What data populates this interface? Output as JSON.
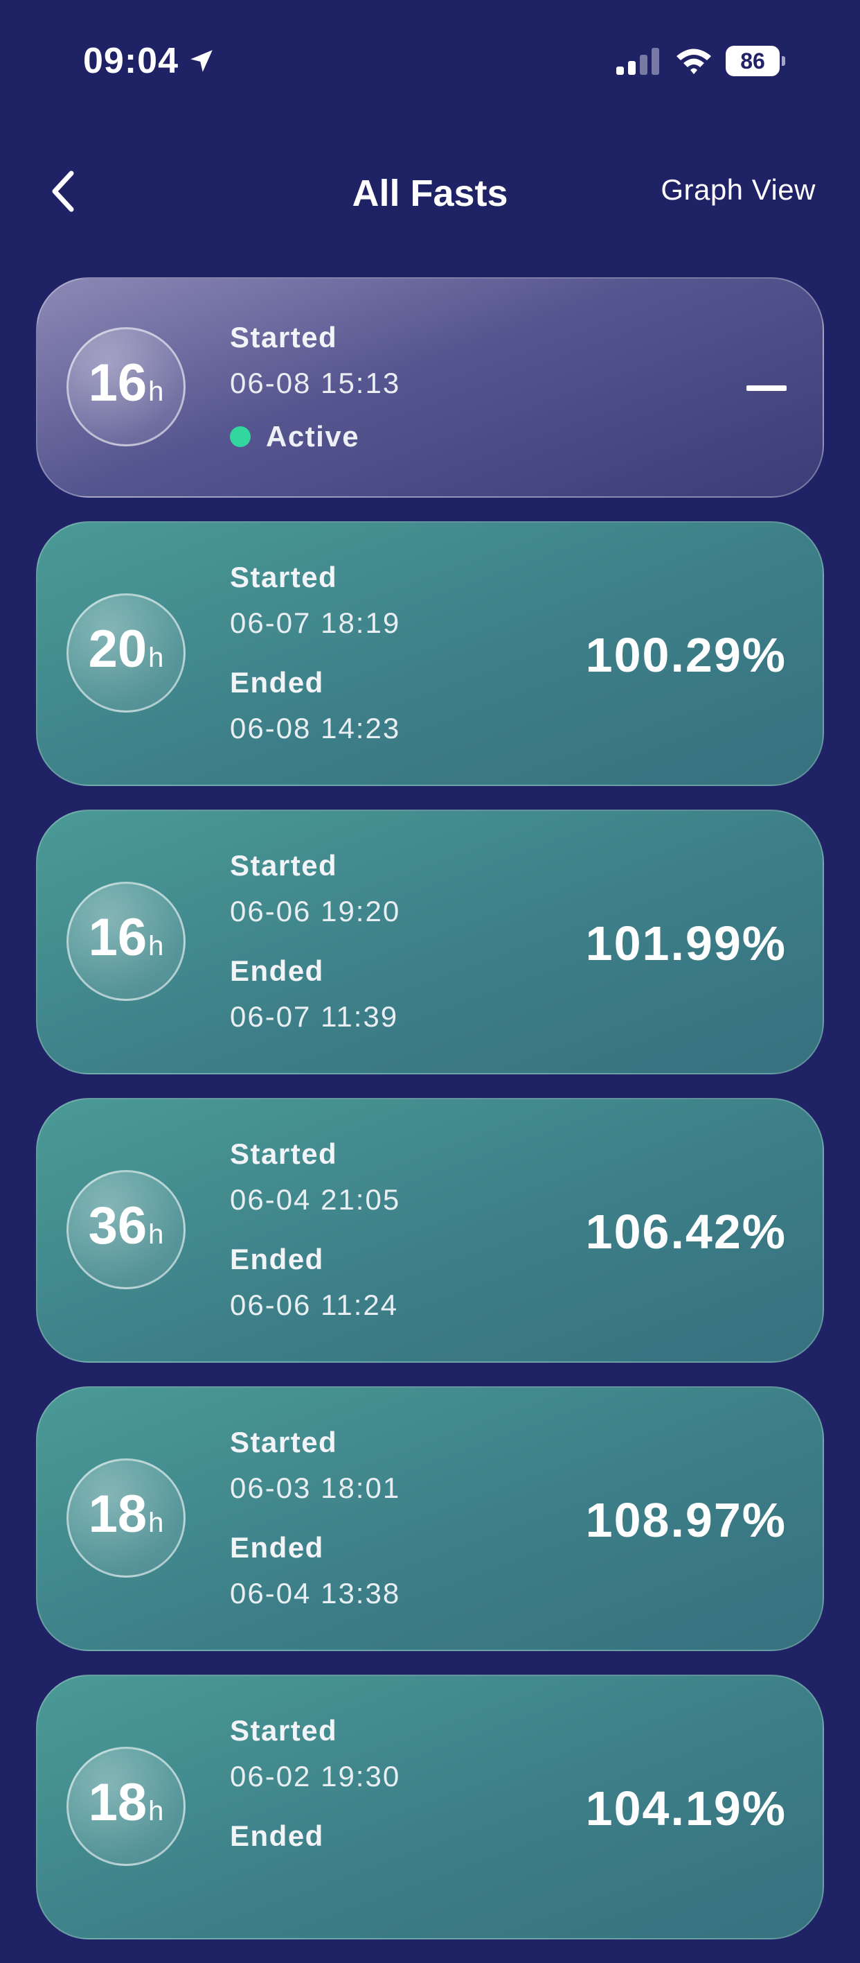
{
  "status_bar": {
    "time": "09:04",
    "battery": "86",
    "icons": [
      "location-arrow-icon",
      "signal-icon",
      "wifi-icon",
      "battery-icon"
    ]
  },
  "nav": {
    "title": "All Fasts",
    "right_action": "Graph View",
    "back_icon": "chevron-left-icon"
  },
  "colors": {
    "background": "#202266",
    "active_card": "#55558f",
    "completed_card": "#3d7f88",
    "active_dot": "#33d69f"
  },
  "labels": {
    "started": "Started",
    "ended": "Ended",
    "hours_unit": "h"
  },
  "active_fast": {
    "hours": "16",
    "started": "06-08 15:13",
    "status": "Active",
    "result": "—"
  },
  "fasts": [
    {
      "hours": "20",
      "started": "06-07 18:19",
      "ended": "06-08 14:23",
      "percent": "100.29%"
    },
    {
      "hours": "16",
      "started": "06-06 19:20",
      "ended": "06-07 11:39",
      "percent": "101.99%"
    },
    {
      "hours": "36",
      "started": "06-04 21:05",
      "ended": "06-06 11:24",
      "percent": "106.42%"
    },
    {
      "hours": "18",
      "started": "06-03 18:01",
      "ended": "06-04 13:38",
      "percent": "108.97%"
    },
    {
      "hours": "18",
      "started": "06-02 19:30",
      "ended": "",
      "percent": "104.19%"
    }
  ]
}
